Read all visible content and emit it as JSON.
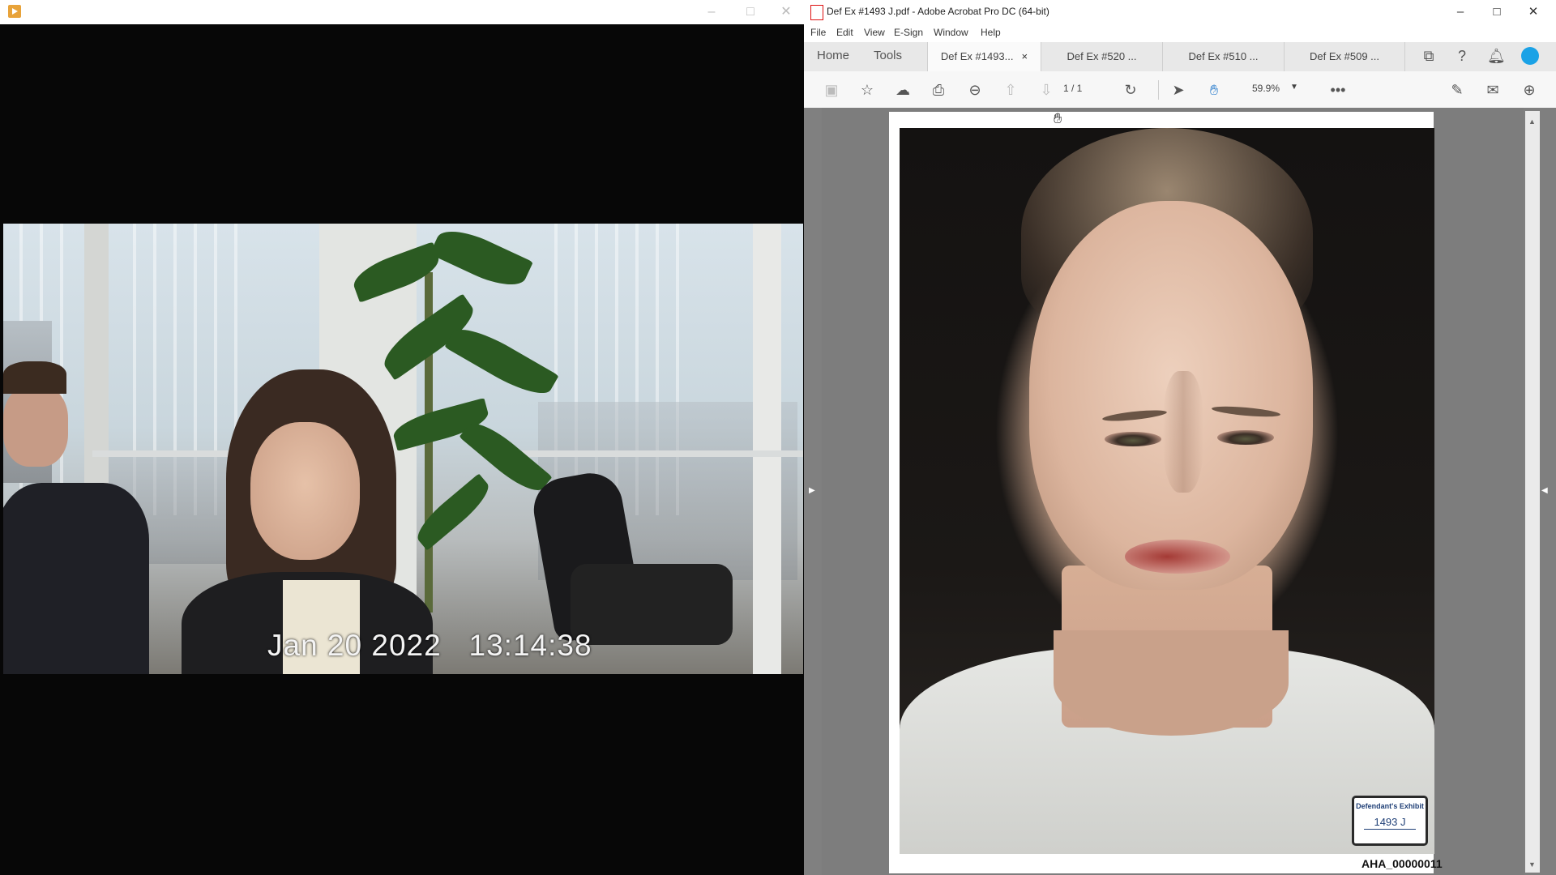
{
  "video_player": {
    "timestamp": "Jan 20 2022   13:14:38",
    "controls": {
      "minimize": "–",
      "maximize": "□",
      "close": "✕"
    }
  },
  "acrobat": {
    "title": "Def Ex  #1493 J.pdf - Adobe Acrobat Pro DC (64-bit)",
    "window_controls": {
      "minimize": "–",
      "maximize": "□",
      "close": "✕"
    },
    "menu": [
      "File",
      "Edit",
      "View",
      "E-Sign",
      "Window",
      "Help"
    ],
    "nav_tabs": [
      "Home",
      "Tools"
    ],
    "doc_tabs": [
      {
        "label": "Def Ex  #1493...",
        "close": "×"
      },
      {
        "label": "Def Ex  #520  ..."
      },
      {
        "label": "Def Ex  #510 ..."
      },
      {
        "label": "Def Ex  #509 ..."
      }
    ],
    "toolbar": {
      "page_indicator": "1   / 1",
      "zoom": "59.9%",
      "icons": [
        "save-icon",
        "star-icon",
        "upload-icon",
        "print-icon",
        "zoom-out-icon",
        "page-up-icon",
        "page-down-icon",
        "rotate-icon",
        "select-arrow-icon",
        "hand-tool-icon",
        "more-icon",
        "sign-icon",
        "email-icon",
        "share-user-icon"
      ]
    },
    "document": {
      "exhibit_sticker": {
        "label": "Defendant's Exhibit",
        "number": "1493 J"
      },
      "bates": "AHA_00000011"
    },
    "accent_color": "#1aa2e6"
  }
}
